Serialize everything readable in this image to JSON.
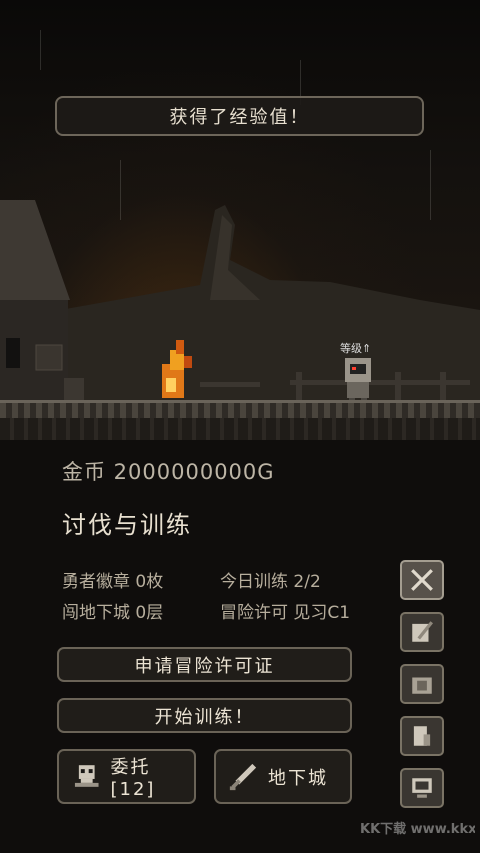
{
  "banner": {
    "text": "获得了经验值！"
  },
  "scene": {
    "hero_tag": "等级⇑"
  },
  "stats": {
    "gold": "金币 2000000000G",
    "section_title": "讨伐与训练",
    "badges": "勇者徽章 0枚",
    "training": "今日训练 2/2",
    "dungeon": "闯地下城 0层",
    "permit": "冒险许可 见习C1"
  },
  "buttons": {
    "apply_permit": "申请冒险许可证",
    "start_training": "开始训练！",
    "commission": "委托[12]",
    "dungeon": "地下城"
  },
  "side_menu": [
    {
      "icon": "crossed-swords-icon"
    },
    {
      "icon": "quill-icon"
    },
    {
      "icon": "bag-icon"
    },
    {
      "icon": "scroll-icon"
    },
    {
      "icon": "monitor-icon"
    }
  ],
  "watermark": "KK下载 www.kkx.net",
  "colors": {
    "fire": "#f0a020",
    "frame": "#6a6357",
    "panel": "#0f0d0c"
  }
}
